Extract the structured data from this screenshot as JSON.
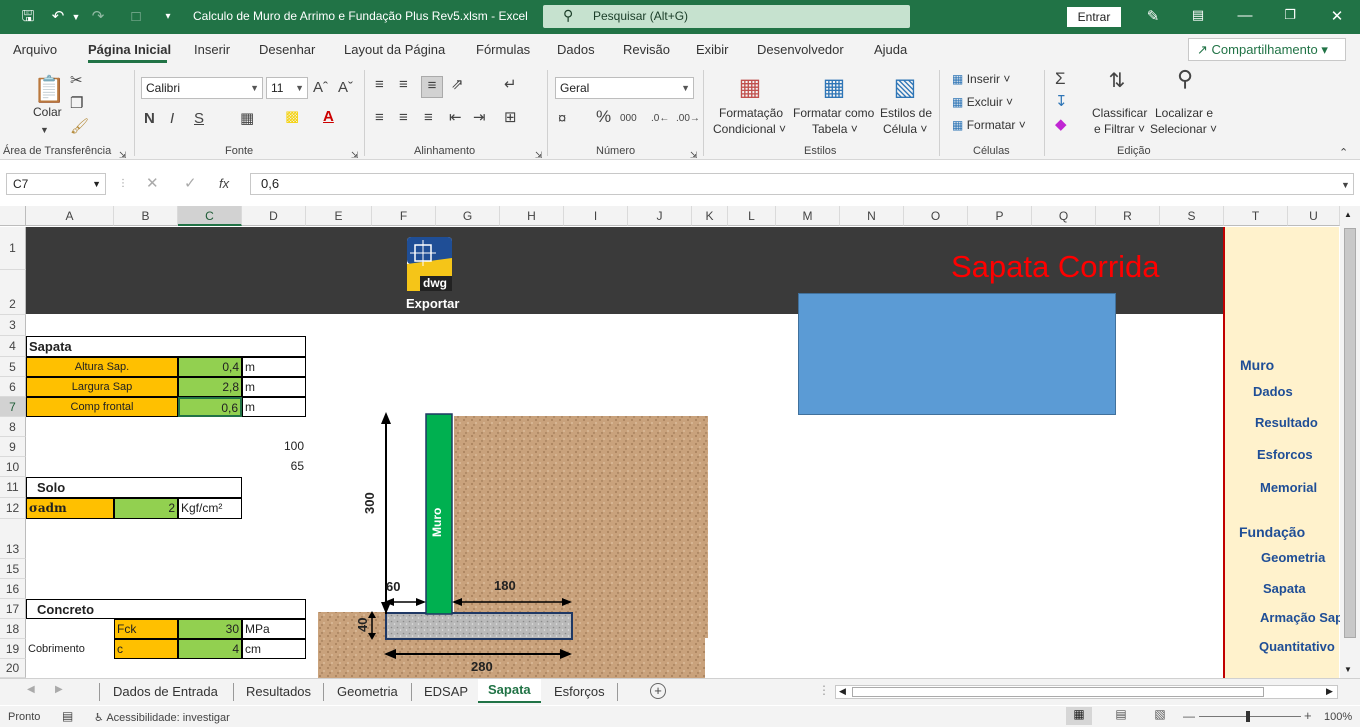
{
  "titlebar": {
    "filename": "Calculo de Muro de Arrimo e Fundação Plus Rev5.xlsm  -  Excel",
    "search_placeholder": "Pesquisar (Alt+G)",
    "signin": "Entrar"
  },
  "menu": {
    "items": [
      "Arquivo",
      "Página Inicial",
      "Inserir",
      "Desenhar",
      "Layout da Página",
      "Fórmulas",
      "Dados",
      "Revisão",
      "Exibir",
      "Desenvolvedor",
      "Ajuda"
    ],
    "share": "Compartilhamento"
  },
  "ribbon": {
    "clipboard": {
      "paste": "Colar",
      "group": "Área de Transferência"
    },
    "font": {
      "name": "Calibri",
      "size": "11",
      "bold": "N",
      "italic": "I",
      "underline": "S",
      "group": "Fonte"
    },
    "alignment": {
      "group": "Alinhamento"
    },
    "number": {
      "format": "Geral",
      "group": "Número"
    },
    "styles": {
      "conditional": [
        "Formatação",
        "Condicional"
      ],
      "table": [
        "Formatar como",
        "Tabela"
      ],
      "cell": [
        "Estilos de",
        "Célula"
      ],
      "group": "Estilos"
    },
    "cells": {
      "insert": "Inserir",
      "delete": "Excluir",
      "format": "Formatar",
      "group": "Células"
    },
    "editing": {
      "sort": [
        "Classificar",
        "e Filtrar"
      ],
      "find": [
        "Localizar e",
        "Selecionar"
      ],
      "group": "Edição"
    }
  },
  "formula_bar": {
    "namebox": "C7",
    "fx": "fx",
    "value": "0,6"
  },
  "columns": [
    "A",
    "B",
    "C",
    "D",
    "E",
    "F",
    "G",
    "H",
    "I",
    "J",
    "K",
    "L",
    "M",
    "N",
    "O",
    "P",
    "Q",
    "R",
    "S",
    "T",
    "U"
  ],
  "rows": [
    "1",
    "2",
    "3",
    "4",
    "5",
    "6",
    "7",
    "8",
    "9",
    "10",
    "11",
    "12",
    "13",
    "15",
    "16",
    "17",
    "18",
    "19",
    "20"
  ],
  "sheet": {
    "export_label": "Exportar",
    "dwg_label": "dwg",
    "title": "Sapata Corrida",
    "sapata_header": "Sapata",
    "altura_label": "Altura Sap.",
    "altura_value": "0,4",
    "altura_unit": "m",
    "largura_label": "Largura Sap",
    "largura_value": "2,8",
    "largura_unit": "m",
    "comp_label": "Comp frontal",
    "comp_value": "0,6",
    "comp_unit": "m",
    "d9": "100",
    "d10": "65",
    "solo_header": "Solo",
    "sadm_label": "σadm",
    "sadm_value": "2",
    "sadm_unit": "Kgf/cm²",
    "concreto_header": "Concreto",
    "fck_label": "Fck",
    "fck_value": "30",
    "fck_unit": "MPa",
    "cobrimento_label": "Cobrimento",
    "c_label": "c",
    "c_value": "4",
    "c_unit": "cm"
  },
  "drawing": {
    "wall_label": "Muro",
    "height_dim": "300",
    "toe_dim": "60",
    "heel_dim": "180",
    "thickness_dim": "40",
    "width_dim": "280"
  },
  "nav": {
    "muro": "Muro",
    "dados": "Dados",
    "resultado": "Resultado",
    "esforcos": "Esforcos",
    "memorial": "Memorial",
    "fundacao": "Fundação",
    "geometria": "Geometria",
    "sapata": "Sapata",
    "armacao": "Armação Sap",
    "quantitativo": "Quantitativo"
  },
  "tabs": [
    "Dados de Entrada",
    "Resultados",
    "Geometria",
    "EDSAP",
    "Sapata",
    "Esforços"
  ],
  "active_tab": "Sapata",
  "status": {
    "ready": "Pronto",
    "accessibility": "Acessibilidade: investigar",
    "zoom": "100%"
  },
  "colors": {
    "excel_green": "#217346",
    "header_dark": "#3a3a3a",
    "title_red": "#ff0000",
    "orange": "#ffc000",
    "green": "#92d050",
    "nav_blue": "#1f4e96",
    "nav_bg": "#fff2cc",
    "blue_box": "#5b9bd5"
  }
}
